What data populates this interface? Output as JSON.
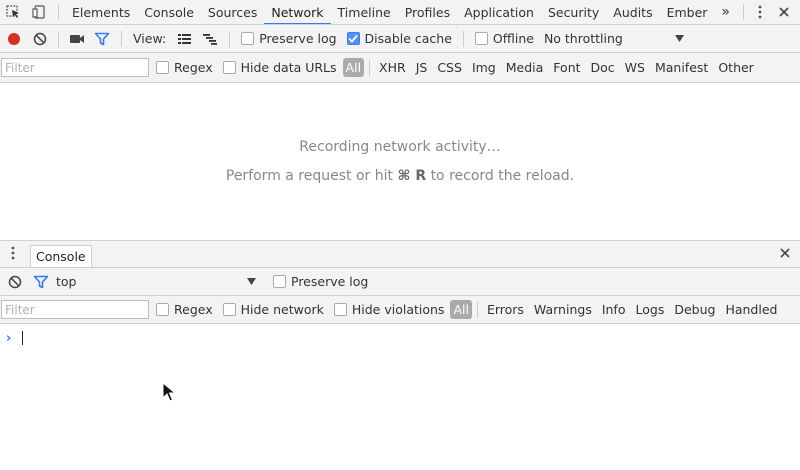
{
  "tabs": [
    {
      "label": "Elements"
    },
    {
      "label": "Console"
    },
    {
      "label": "Sources"
    },
    {
      "label": "Network"
    },
    {
      "label": "Timeline"
    },
    {
      "label": "Profiles"
    },
    {
      "label": "Application"
    },
    {
      "label": "Security"
    },
    {
      "label": "Audits"
    },
    {
      "label": "Ember"
    }
  ],
  "active_tab": "Network",
  "more_tabs_label": "»",
  "network_toolbar": {
    "view_label": "View:",
    "preserve_log": {
      "label": "Preserve log",
      "checked": false
    },
    "disable_cache": {
      "label": "Disable cache",
      "checked": true
    },
    "offline": {
      "label": "Offline",
      "checked": false
    },
    "throttling": "No throttling"
  },
  "network_filter": {
    "placeholder": "Filter",
    "regex_label": "Regex",
    "hide_data_urls_label": "Hide data URLs",
    "types": [
      "All",
      "XHR",
      "JS",
      "CSS",
      "Img",
      "Media",
      "Font",
      "Doc",
      "WS",
      "Manifest",
      "Other"
    ],
    "active_type": "All"
  },
  "network_empty": {
    "line1": "Recording network activity…",
    "line2_pre": "Perform a request or hit",
    "line2_key": "⌘ R",
    "line2_post": "to record the reload."
  },
  "drawer": {
    "tab_label": "Console"
  },
  "console_toolbar": {
    "context": "top",
    "preserve_log": {
      "label": "Preserve log",
      "checked": false
    }
  },
  "console_filter": {
    "placeholder": "Filter",
    "regex_label": "Regex",
    "hide_network_label": "Hide network",
    "hide_violations_label": "Hide violations",
    "levels": [
      "All",
      "Errors",
      "Warnings",
      "Info",
      "Logs",
      "Debug",
      "Handled"
    ],
    "active_level": "All"
  },
  "colors": {
    "accent": "#2f7cf6",
    "record_red": "#d93025",
    "toolbar_bg": "#f3f3f3",
    "checkbox_checked": "#4d90fe"
  }
}
